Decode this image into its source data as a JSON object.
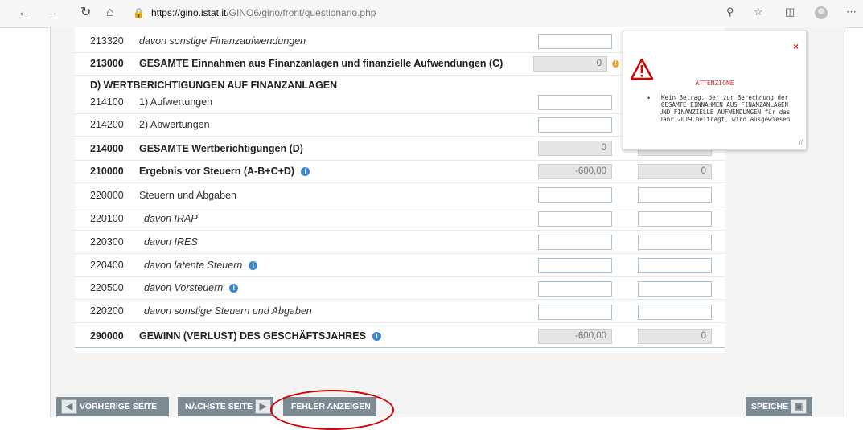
{
  "browser": {
    "url_host": "https://gino.istat.it",
    "url_path": "/GINO6/gino/front/questionario.php"
  },
  "rows": [
    {
      "code": "213320",
      "label": "davon sonstige Finanzaufwendungen",
      "style": "italic",
      "value": ""
    },
    {
      "code": "213000",
      "label": "GESAMTE Einnahmen aus Finanzanlagen und finanzielle Aufwendungen (C)",
      "style": "bold",
      "value": "0"
    },
    {
      "code": "214100",
      "label": "1) Aufwertungen",
      "style": "normal",
      "value": ""
    },
    {
      "code": "214200",
      "label": "2) Abwertungen",
      "style": "normal",
      "value": ""
    },
    {
      "code": "214000",
      "label": "GESAMTE Wertberichtigungen (D)",
      "style": "bold",
      "value": "0",
      "value2": "0"
    },
    {
      "code": "210000",
      "label": "Ergebnis vor Steuern (A-B+C+D)",
      "style": "bold",
      "value": "-600,00",
      "value2": "0"
    },
    {
      "code": "220000",
      "label": "Steuern und Abgaben",
      "style": "normal",
      "value": ""
    },
    {
      "code": "220100",
      "label": "davon IRAP",
      "style": "italic",
      "value": ""
    },
    {
      "code": "220300",
      "label": "davon IRES",
      "style": "italic",
      "value": ""
    },
    {
      "code": "220400",
      "label": "davon latente Steuern",
      "style": "italic",
      "value": ""
    },
    {
      "code": "220500",
      "label": "davon Vorsteuern",
      "style": "italic",
      "value": ""
    },
    {
      "code": "220200",
      "label": "davon sonstige Steuern und Abgaben",
      "style": "italic",
      "value": ""
    },
    {
      "code": "290000",
      "label": "GEWINN (VERLUST) DES GESCHÄFTSJAHRES",
      "style": "bold",
      "value": "-600,00",
      "value2": "0"
    }
  ],
  "section_d_heading": "D) WERTBERICHTIGUNGEN AUF FINANZANLAGEN",
  "info_glyph": "i",
  "popup": {
    "close_glyph": "×",
    "title": "ATTENZIONE",
    "message": "Kein Betrag, der zur Berechnung der GESAMTE EINNAHMEN AUS FINANZANLAGEN UND FINANZIELLE AUFWENDUNGEN für das Jahr 2019 beiträgt, wird ausgewiesen"
  },
  "buttons": {
    "prev": "VORHERIGE SEITE",
    "next": "NÄCHSTE SEITE",
    "errors": "FEHLER ANZEIGEN",
    "save": "SPEICHE"
  },
  "colors": {
    "accent_info": "#3a86d1",
    "error_red": "#c9302c",
    "button_gray": "#7b8a93",
    "highlight_ellipse": "#d40000"
  }
}
